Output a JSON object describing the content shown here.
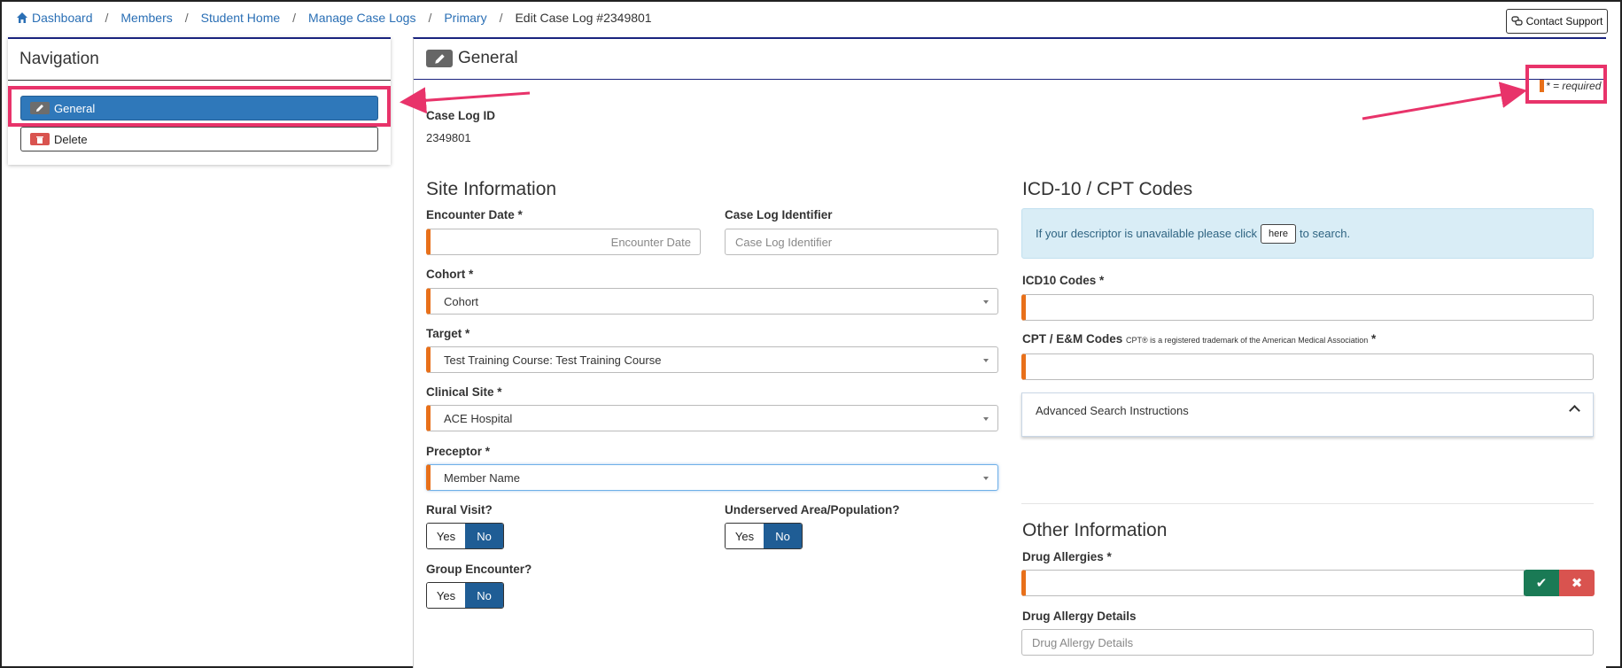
{
  "breadcrumb": {
    "items": [
      "Dashboard",
      "Members",
      "Student Home",
      "Manage Case Logs",
      "Primary"
    ],
    "current": "Edit Case Log #2349801",
    "separator": "/"
  },
  "header": {
    "contact_support": "Contact Support"
  },
  "navigation": {
    "title": "Navigation",
    "general": "General",
    "delete": "Delete"
  },
  "main": {
    "title": "General",
    "required_legend": "* = required"
  },
  "case_log": {
    "label": "Case Log ID",
    "value": "2349801"
  },
  "site_info": {
    "title": "Site Information",
    "encounter_date": {
      "label": "Encounter Date *",
      "placeholder": "Encounter Date"
    },
    "identifier": {
      "label": "Case Log Identifier",
      "placeholder": "Case Log Identifier"
    },
    "cohort": {
      "label": "Cohort *",
      "value": "Cohort"
    },
    "target": {
      "label": "Target *",
      "value": "Test Training Course: Test Training Course"
    },
    "clinical_site": {
      "label": "Clinical Site *",
      "value": "ACE Hospital"
    },
    "preceptor": {
      "label": "Preceptor *",
      "value": "Member Name"
    },
    "rural_visit": {
      "label": "Rural Visit?",
      "yes": "Yes",
      "no": "No"
    },
    "underserved": {
      "label": "Underserved Area/Population?",
      "yes": "Yes",
      "no": "No"
    },
    "group_encounter": {
      "label": "Group Encounter?",
      "yes": "Yes",
      "no": "No"
    }
  },
  "codes": {
    "title": "ICD-10 / CPT Codes",
    "info_before": "If your descriptor is unavailable please click",
    "info_button": "here",
    "info_after": "to search.",
    "icd10_label": "ICD10 Codes *",
    "cpt_label": "CPT / E&M Codes",
    "cpt_note": "CPT® is a registered trademark of the American Medical Association",
    "cpt_required": "*",
    "advanced": "Advanced Search Instructions"
  },
  "other_info": {
    "title": "Other Information",
    "drug_allergies_label": "Drug Allergies *",
    "drug_allergy_details_label": "Drug Allergy Details",
    "drug_allergy_details_placeholder": "Drug Allergy Details"
  },
  "colors": {
    "accent": "#2f78ba",
    "required": "#e8701a",
    "annotation": "#e8336a",
    "toggle_active": "#1f5d95"
  }
}
